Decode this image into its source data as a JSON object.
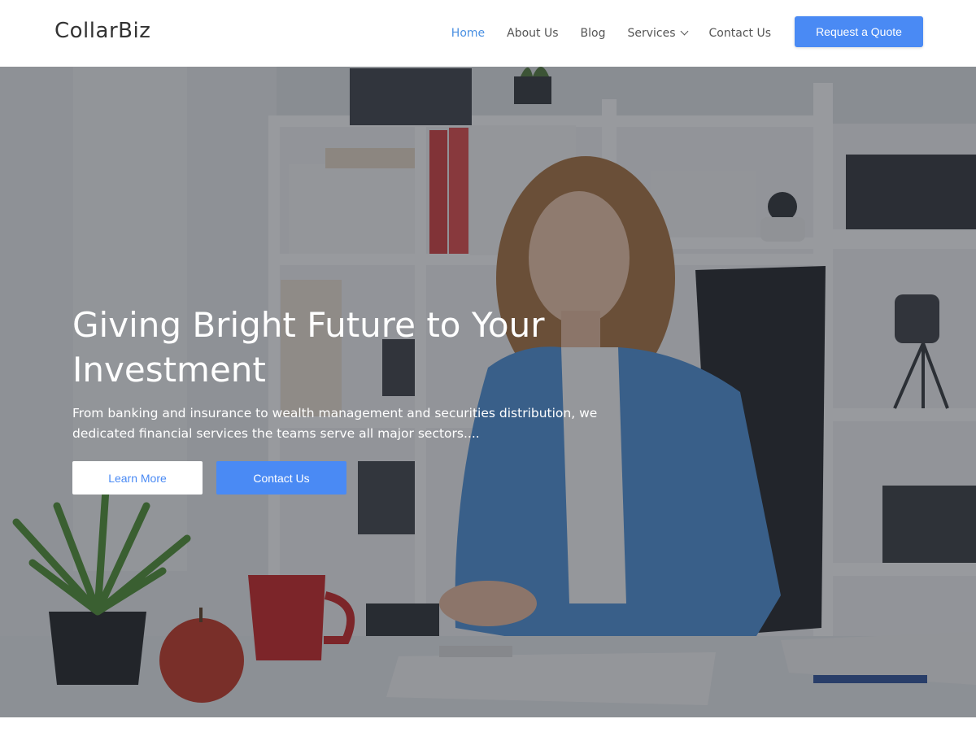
{
  "header": {
    "logo": "CollarBiz",
    "nav": [
      {
        "label": "Home",
        "active": true
      },
      {
        "label": "About Us",
        "active": false
      },
      {
        "label": "Blog",
        "active": false
      },
      {
        "label": "Services",
        "active": false,
        "has_dropdown": true
      },
      {
        "label": "Contact Us",
        "active": false
      }
    ],
    "cta_label": "Request a Quote"
  },
  "hero": {
    "title": "Giving Bright Future to Your Investment",
    "description": "From banking and insurance to wealth management and securities distribution, we dedicated financial services the teams serve all major sectors....",
    "primary_button": "Learn More",
    "secondary_button": "Contact Us"
  },
  "icons": {
    "services_dropdown": "chevron-down-icon"
  },
  "colors": {
    "accent": "#4a8af4",
    "nav_active": "#4a90e2",
    "nav_text": "#555555",
    "logo_text": "#333333",
    "hero_text": "#ffffff"
  }
}
